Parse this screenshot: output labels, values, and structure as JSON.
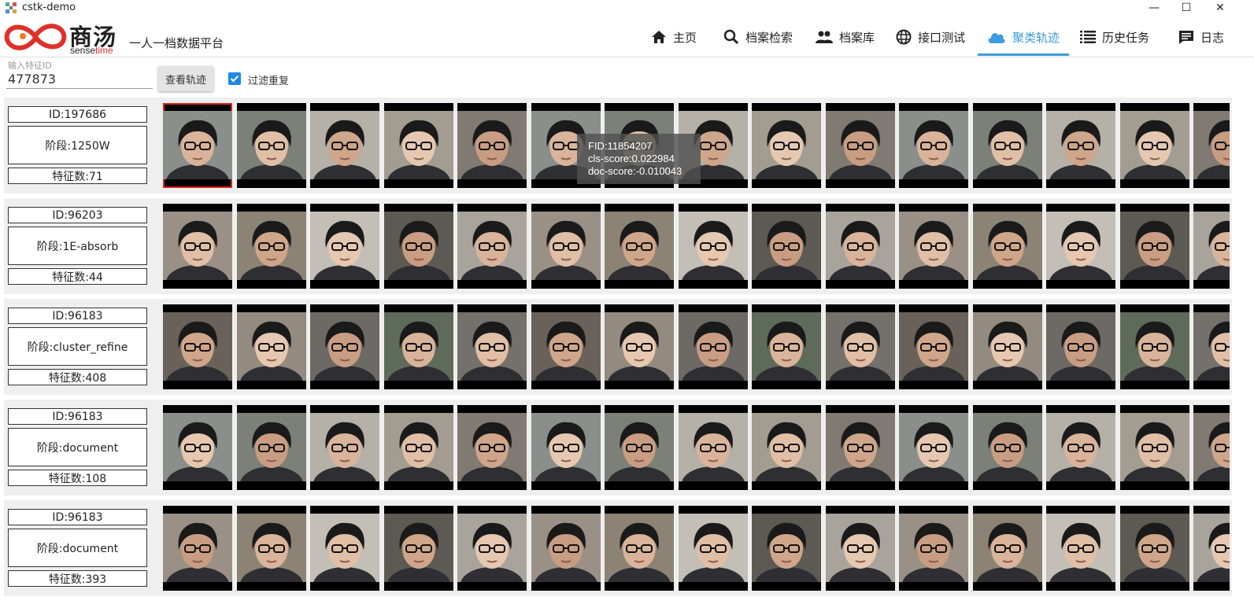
{
  "window": {
    "title": "cstk-demo",
    "minimize": "—",
    "maximize": "☐",
    "close": "✕"
  },
  "brand": {
    "cn": "商汤",
    "en_a": "sense",
    "en_b": "time",
    "slogan": "一人一档数据平台"
  },
  "nav": [
    {
      "label": "主页",
      "icon": "home-icon",
      "active": false
    },
    {
      "label": "档案检索",
      "icon": "search-icon",
      "active": false
    },
    {
      "label": "档案库",
      "icon": "people-icon",
      "active": false
    },
    {
      "label": "接口测试",
      "icon": "globe-icon",
      "active": false
    },
    {
      "label": "聚类轨迹",
      "icon": "cloud-icon",
      "active": true
    },
    {
      "label": "历史任务",
      "icon": "list-icon",
      "active": false
    },
    {
      "label": "日志",
      "icon": "message-icon",
      "active": false
    }
  ],
  "search": {
    "label": "输入特征ID",
    "value": "477873",
    "button": "查看轨迹",
    "filter_label": "过滤重复",
    "filter_checked": true
  },
  "rows": [
    {
      "id": "ID:197686",
      "stage": "阶段:1250W",
      "count": "特征数:71"
    },
    {
      "id": "ID:96203",
      "stage": "阶段:1E-absorb",
      "count": "特征数:44"
    },
    {
      "id": "ID:96183",
      "stage": "阶段:cluster_refine",
      "count": "特征数:408"
    },
    {
      "id": "ID:96183",
      "stage": "阶段:document",
      "count": "特征数:108"
    },
    {
      "id": "ID:96183",
      "stage": "阶段:document",
      "count": "特征数:393"
    }
  ],
  "tooltip": {
    "fid": "FID:11854207",
    "cls": "cls-score:0.022984",
    "doc": "doc-score:-0.010043"
  },
  "colors": {
    "accent": "#3a9be0",
    "selected_border": "#d9261c",
    "row_bg": "#efefef",
    "checkbox": "#1e88e5"
  }
}
